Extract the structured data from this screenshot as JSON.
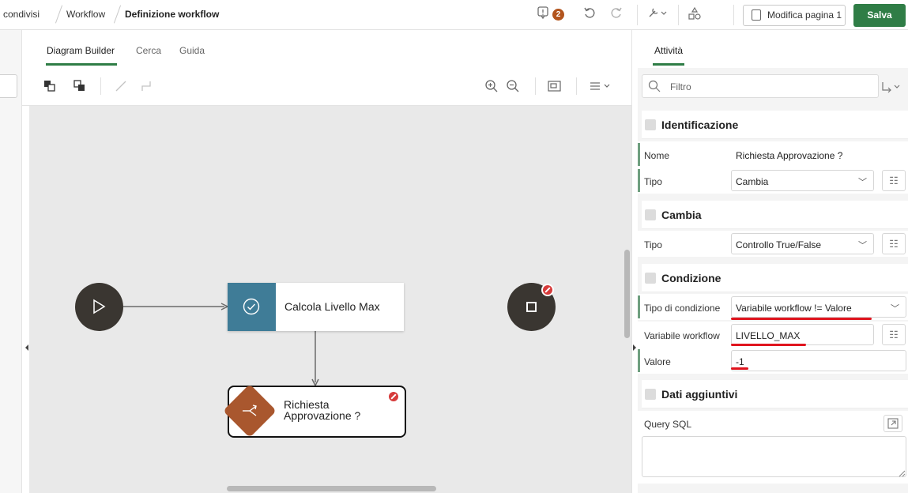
{
  "breadcrumb": {
    "items": [
      "condivisi",
      "Workflow",
      "Definizione workflow"
    ]
  },
  "toolbar_top": {
    "issues_count": "2",
    "edit_page_label": "Modifica pagina 1",
    "save_label": "Salva"
  },
  "tabs": {
    "items": [
      "Diagram Builder",
      "Cerca",
      "Guida"
    ]
  },
  "diagram": {
    "task_label": "Calcola Livello Max",
    "switch_label_line1": "Richiesta",
    "switch_label_line2": "Approvazione ?"
  },
  "right_panel": {
    "tab_label": "Attività",
    "filter_placeholder": "Filtro",
    "sections": {
      "identificazione": {
        "title": "Identificazione",
        "nome_label": "Nome",
        "nome_value": "Richiesta Approvazione ?",
        "tipo_label": "Tipo",
        "tipo_value": "Cambia"
      },
      "cambia": {
        "title": "Cambia",
        "tipo_label": "Tipo",
        "tipo_value": "Controllo True/False"
      },
      "condizione": {
        "title": "Condizione",
        "tipo_label": "Tipo di condizione",
        "tipo_value": "Variabile workflow != Valore",
        "variabile_label": "Variabile workflow",
        "variabile_value": "LIVELLO_MAX",
        "valore_label": "Valore",
        "valore_value": "-1"
      },
      "dati_aggiuntivi": {
        "title": "Dati aggiuntivi",
        "query_label": "Query SQL"
      }
    }
  },
  "colors": {
    "accent_green": "#2f7d46",
    "task_blue": "#3f7c97",
    "switch_brown": "#a9572e",
    "error_red": "#d63b3b",
    "highlight_red": "#e0141e"
  }
}
